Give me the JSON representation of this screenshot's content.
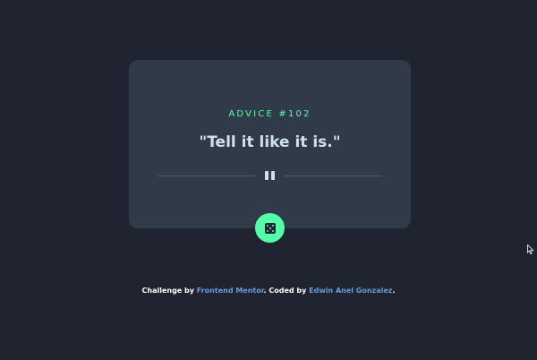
{
  "advice": {
    "label": "ADVICE #102",
    "quote": "\"Tell it like it is.\""
  },
  "icons": {
    "divider": "pause-icon",
    "button": "dice-icon",
    "cursor": "mouse-cursor-icon"
  },
  "footer": {
    "challenge_prefix": "Challenge by",
    "challenge_link": "Frontend Mentor",
    "coded_prefix": ". Coded by",
    "coded_link": "Edwin Anel Gonzalez",
    "suffix": "."
  },
  "colors": {
    "background": "#1f2430",
    "card": "#313a49",
    "accent": "#52ffa8",
    "quote": "#cee3e9",
    "link": "#6c9bd9",
    "divider": "#4f5d74"
  }
}
